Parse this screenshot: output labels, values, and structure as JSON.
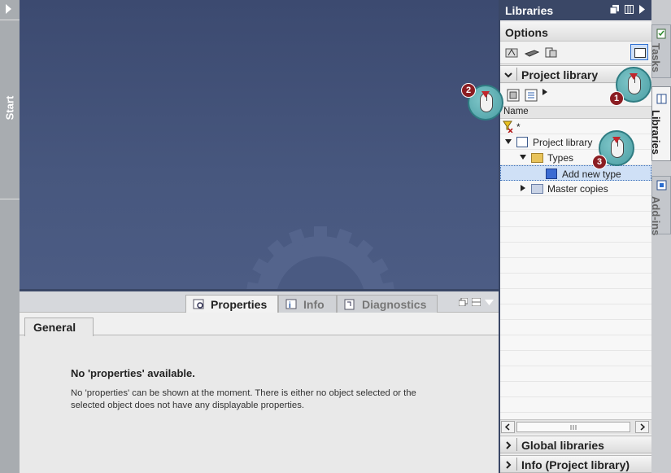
{
  "start_strip": {
    "label": "Start"
  },
  "inspector": {
    "tabs": [
      {
        "label": "Properties",
        "active": true,
        "icon": "properties-icon"
      },
      {
        "label": "Info",
        "active": false,
        "icon": "info-icon"
      },
      {
        "label": "Diagnostics",
        "active": false,
        "icon": "diagnostics-icon"
      }
    ],
    "general_tab": "General",
    "message_title": "No 'properties' available.",
    "message_text": "No 'properties' can be shown at the moment. There is either no object selected or the selected object does not have any displayable properties."
  },
  "task_panel": {
    "title": "Libraries",
    "options_label": "Options",
    "project_library_header": "Project library",
    "column_name": "Name",
    "filter_text": "*",
    "tree": [
      {
        "label": "Project library",
        "expanded": true,
        "icon": "library-book-icon"
      },
      {
        "label": "Types",
        "expanded": true,
        "icon": "types-folder-icon"
      },
      {
        "label": "Add new type",
        "selected": true,
        "icon": "add-type-icon"
      },
      {
        "label": "Master copies",
        "expanded": false,
        "icon": "folder-icon"
      }
    ],
    "global_libraries_header": "Global libraries",
    "info_header": "Info (Project library)"
  },
  "side_tabs": [
    {
      "label": "Tasks",
      "active": false
    },
    {
      "label": "Libraries",
      "active": true
    },
    {
      "label": "Add-ins",
      "active": false
    }
  ],
  "callouts": [
    {
      "number": "1"
    },
    {
      "number": "2"
    },
    {
      "number": "3"
    }
  ],
  "colors": {
    "header_bg": "#3a4766",
    "workarea_bg": "#44537a",
    "selection_bg": "#cfe0f6",
    "callout_teal": "#5aaeb3",
    "callout_badge": "#8b1d22"
  }
}
